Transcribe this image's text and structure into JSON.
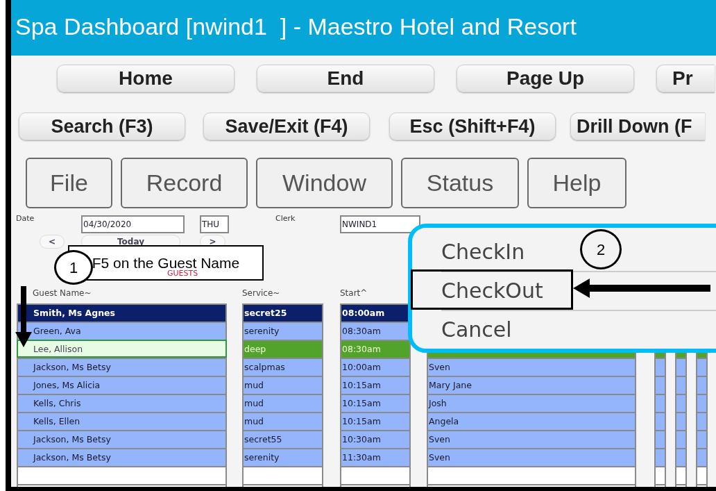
{
  "window": {
    "title": "Spa Dashboard [nwind1  ] - Maestro Hotel and Resort"
  },
  "nav_buttons": [
    "Home",
    "End",
    "Page Up",
    "Pr"
  ],
  "action_buttons": [
    "Search (F3)",
    "Save/Exit (F4)",
    "Esc (Shift+F4)",
    "Drill Down (F"
  ],
  "menu": [
    "File",
    "Record",
    "Window",
    "Status",
    "Help"
  ],
  "form": {
    "date_label": "Date",
    "date": "04/30/2020",
    "day": "THU",
    "clerk_label": "Clerk",
    "clerk": "NWIND1",
    "prev": "<",
    "today": "Today",
    "next": ">"
  },
  "section_label": "GUESTS",
  "table": {
    "columns": [
      "Guest Name~",
      "Service~",
      "Start^"
    ],
    "rows": [
      {
        "selected": true,
        "focused": false,
        "guest": "Smith, Ms Agnes",
        "service": "secret25",
        "start": "08:00am"
      },
      {
        "selected": false,
        "focused": false,
        "guest": "Green, Ava",
        "service": "serenity",
        "start": "08:30am"
      },
      {
        "selected": false,
        "focused": true,
        "guest": "Lee, Allison",
        "service": "deep",
        "start": "08:30am"
      },
      {
        "selected": false,
        "focused": false,
        "guest": "Jackson, Ms Betsy",
        "service": "scalpmas",
        "start": "10:00am",
        "staff": "Sven"
      },
      {
        "selected": false,
        "focused": false,
        "guest": "Jones, Ms Alicia",
        "service": "mud",
        "start": "10:15am",
        "staff": "Mary Jane"
      },
      {
        "selected": false,
        "focused": false,
        "guest": "Kells, Chris",
        "service": "mud",
        "start": "10:15am",
        "staff": "Josh"
      },
      {
        "selected": false,
        "focused": false,
        "guest": "Kells, Ellen",
        "service": "mud",
        "start": "10:15am",
        "staff": "Angela"
      },
      {
        "selected": false,
        "focused": false,
        "guest": "Jackson, Ms Betsy",
        "service": "secret55",
        "start": "10:30am",
        "staff": "Sven"
      },
      {
        "selected": false,
        "focused": false,
        "guest": "Jackson, Ms Betsy",
        "service": "serenity",
        "start": "11:30am",
        "staff": "Sven"
      },
      {
        "selected": false,
        "focused": false
      },
      {
        "selected": false,
        "focused": false
      }
    ]
  },
  "popup_menu": {
    "items": [
      "CheckIn",
      "CheckOut",
      "Cancel"
    ]
  },
  "annotations": {
    "callout": "F5 on the Guest Name",
    "step_1": "1",
    "step_2": "2"
  }
}
